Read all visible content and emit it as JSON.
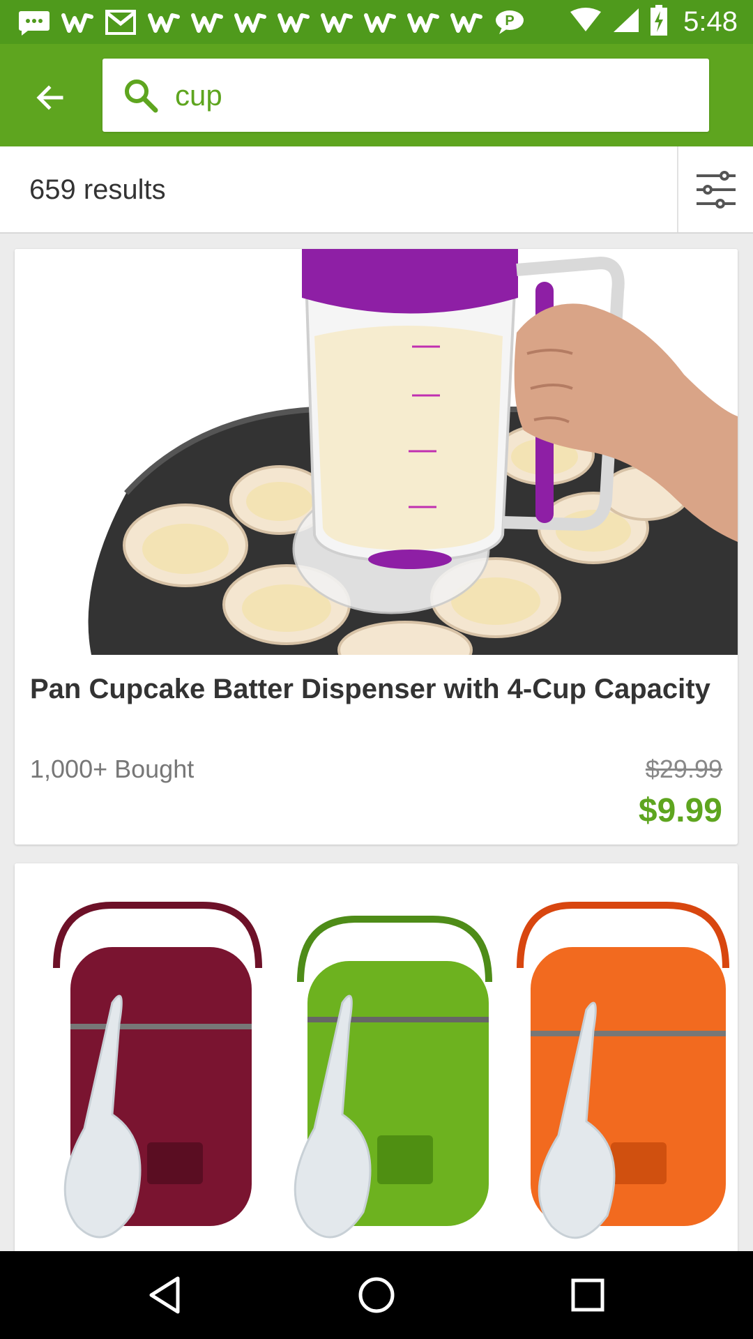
{
  "status_bar": {
    "time": "5:48",
    "notification_icons": [
      "message-icon",
      "wish-icon",
      "gmail-icon",
      "wish-icon",
      "wish-icon",
      "wish-icon",
      "wish-icon",
      "wish-icon",
      "wish-icon",
      "wish-icon",
      "wish-icon",
      "chat-icon"
    ],
    "system_icons": [
      "wifi-icon",
      "signal-icon",
      "battery-charging-icon"
    ]
  },
  "search": {
    "value": "cup"
  },
  "results": {
    "count_text": "659 results"
  },
  "products": [
    {
      "title": "Pan Cupcake Batter Dispenser with 4-Cup Capacity",
      "bought": "1,000+ Bought",
      "original_price": "$29.99",
      "price": "$9.99"
    },
    {
      "title": "",
      "image_desc": "three mini rice cookers red green orange"
    }
  ],
  "colors": {
    "brand_green": "#5ea51f",
    "status_green": "#4f9a1c",
    "dispenser_purple": "#8e1fa5"
  }
}
